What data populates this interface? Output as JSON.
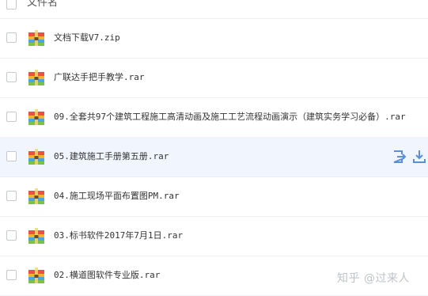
{
  "header": {
    "column_name": "文件名"
  },
  "files": [
    {
      "name": "文档下载V7.zip",
      "icon": "archive-icon"
    },
    {
      "name": "广联达手把手教学.rar",
      "icon": "archive-icon"
    },
    {
      "name": "09.全套共97个建筑工程施工高清动画及施工工艺流程动画演示（建筑实务学习必备）.rar",
      "icon": "archive-icon"
    },
    {
      "name": "05.建筑施工手册第五册.rar",
      "icon": "archive-icon",
      "hovered": true
    },
    {
      "name": "04.施工现场平面布置图PM.rar",
      "icon": "archive-icon"
    },
    {
      "name": "03.标书软件2017年7月1日.rar",
      "icon": "archive-icon"
    },
    {
      "name": "02.横道图软件专业版.rar",
      "icon": "archive-icon"
    }
  ],
  "row_actions": {
    "share_icon": "share-icon",
    "download_icon": "download-icon"
  },
  "watermark": "知乎 @过来人",
  "colors": {
    "hover_row": "#f1f6fe",
    "action_icon": "#5a8ed6",
    "border": "#f0f2f6"
  }
}
